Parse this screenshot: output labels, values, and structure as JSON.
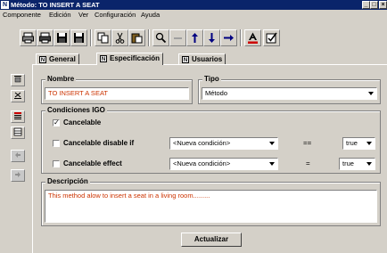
{
  "window": {
    "title": "Método: TO INSERT A SEAT",
    "app_icon": "N",
    "controls": [
      "_",
      "□",
      "×"
    ]
  },
  "menu": [
    "Componente",
    "Edición",
    "Ver",
    "Configuración",
    "Ayuda"
  ],
  "toolbar_icons": [
    "print-icon",
    "print-preview-icon",
    "save-icon",
    "save-all-icon",
    "copy-icon",
    "cut-icon",
    "paste-icon",
    "search-icon",
    "minus-icon",
    "arrow-up-icon",
    "arrow-down-icon",
    "arrow-right-icon",
    "text-color-icon",
    "check-box-icon"
  ],
  "tabs": [
    {
      "icon": "N",
      "label": "General"
    },
    {
      "icon": "N",
      "label": "Especificación"
    },
    {
      "icon": "N",
      "label": "Usuarios"
    }
  ],
  "left_toolbar_icons": [
    "align-top-icon",
    "align-center-icon",
    "list-icon",
    "table-icon",
    "import-icon",
    "export-icon"
  ],
  "form": {
    "nombre_label": "Nombre",
    "nombre_value": "TO INSERT A SEAT",
    "tipo_label": "Tipo",
    "tipo_value": "Método",
    "condiciones_label": "Condiciones IGO",
    "cancelable_label": "Cancelable",
    "cancelable_checked": true,
    "cancel_disable_label": "Cancelable disable if",
    "cancel_disable_condition": "<Nueva condición>",
    "cancel_disable_operator": "==",
    "cancel_disable_value": "true",
    "cancel_effect_label": "Cancelable effect",
    "cancel_effect_condition": "<Nueva condición>",
    "cancel_effect_operator": "=",
    "cancel_effect_value": "true",
    "descripcion_label": "Descripción",
    "descripcion_value": "This method alow to insert a seat in a living room.........",
    "actualizar_label": "Actualizar"
  },
  "colors": {
    "title_bar": "#0a246a",
    "window_bg": "#d4d0c8",
    "value_text": "#cc3300"
  }
}
